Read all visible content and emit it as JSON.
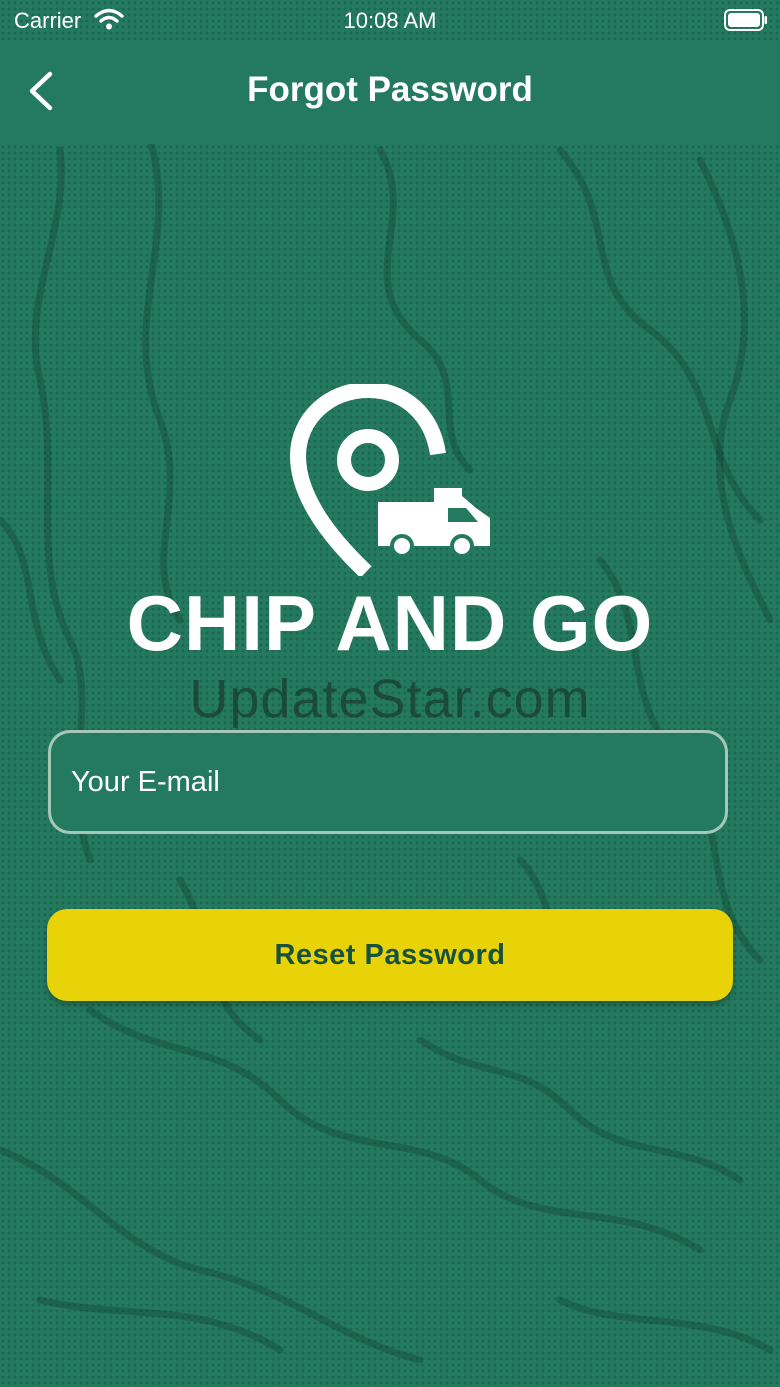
{
  "status_bar": {
    "carrier": "Carrier",
    "time": "10:08 AM",
    "wifi_icon": "wifi-icon",
    "battery_icon": "battery-full-icon"
  },
  "nav": {
    "title": "Forgot Password",
    "back_icon": "chevron-left-icon"
  },
  "logo": {
    "icon": "location-pin-truck-icon",
    "brand_name": "CHIP AND GO",
    "watermark": "UpdateStar.com"
  },
  "form": {
    "email_placeholder": "Your E-mail",
    "email_value": "",
    "reset_label": "Reset Password"
  },
  "colors": {
    "background": "#247a5e",
    "button": "#e8d208",
    "button_text": "#17523d",
    "text": "#ffffff"
  }
}
